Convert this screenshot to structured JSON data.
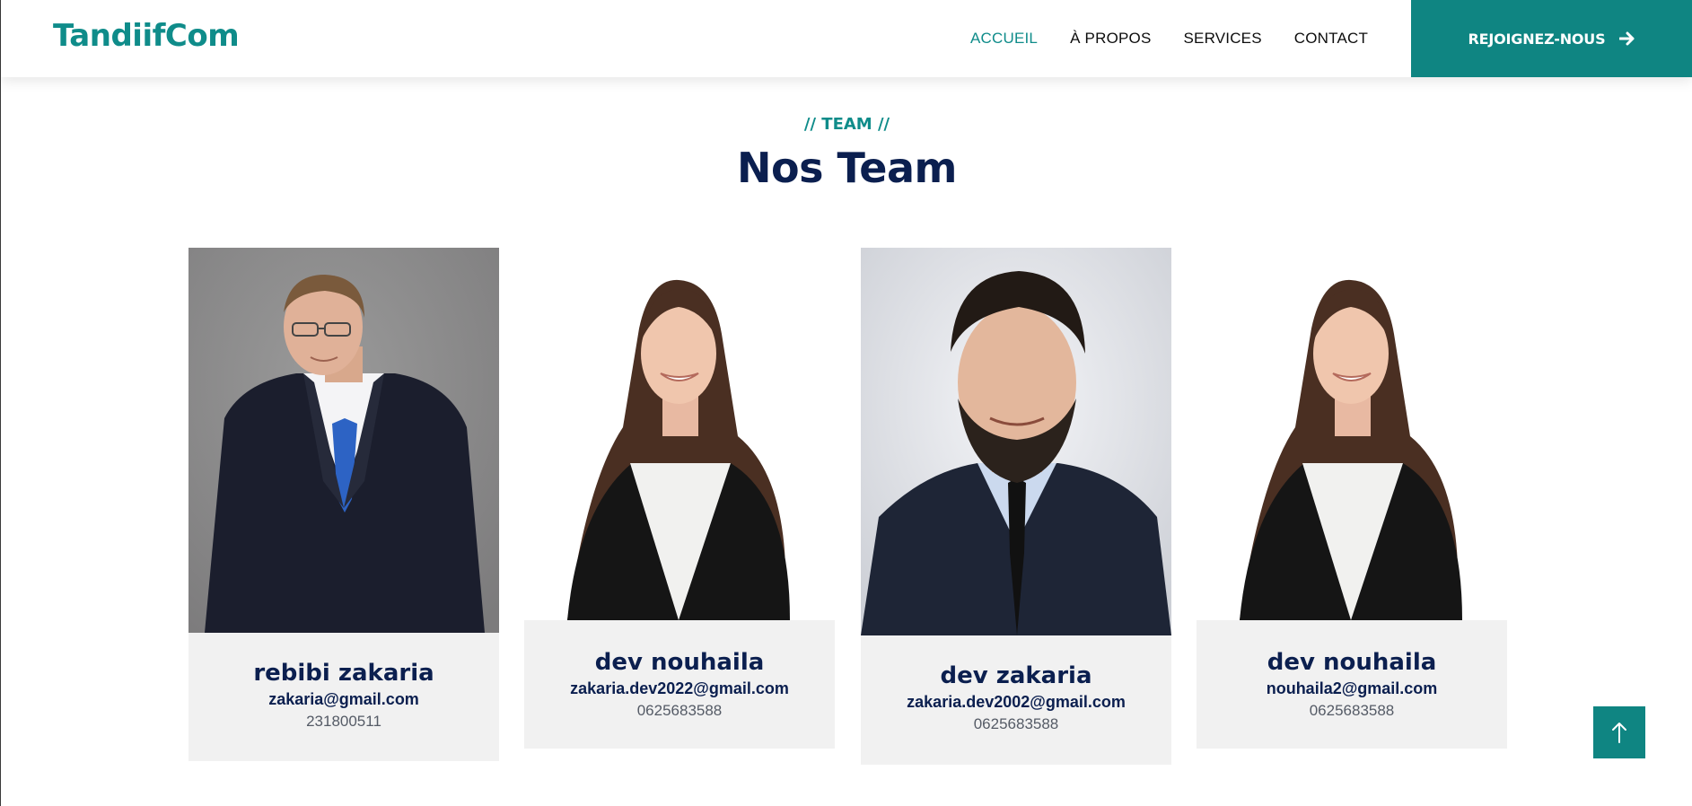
{
  "navbar": {
    "brand": "TandiifCom",
    "links": [
      {
        "label": "ACCUEIL",
        "active": true
      },
      {
        "label": "À PROPOS",
        "active": false
      },
      {
        "label": "SERVICES",
        "active": false
      },
      {
        "label": "CONTACT",
        "active": false
      }
    ],
    "cta_label": "REJOIGNEZ-NOUS",
    "cta_icon": "arrow-right-icon"
  },
  "section": {
    "eyebrow": "// TEAM //",
    "title": "Nos Team"
  },
  "team": [
    {
      "name": "rebibi zakaria",
      "email": "zakaria@gmail.com",
      "phone": "231800511"
    },
    {
      "name": "dev nouhaila",
      "email": "zakaria.dev2022@gmail.com",
      "phone": "0625683588"
    },
    {
      "name": "dev zakaria",
      "email": "zakaria.dev2002@gmail.com",
      "phone": "0625683588"
    },
    {
      "name": "dev nouhaila",
      "email": "nouhaila2@gmail.com",
      "phone": "0625683588"
    }
  ],
  "back_to_top_icon": "arrow-up-icon",
  "colors": {
    "accent": "#0f8582",
    "brand": "#0f8c8a",
    "heading": "#0b1f4f",
    "card_bg": "#f1f1f1"
  }
}
